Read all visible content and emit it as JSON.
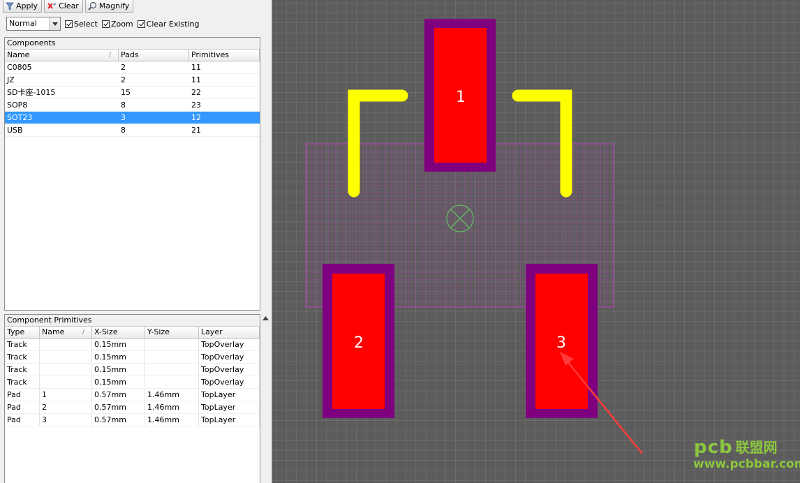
{
  "toolbar": {
    "apply_label": "Apply",
    "clear_label": "Clear",
    "magnify_label": "Magnify"
  },
  "options": {
    "mode_value": "Normal",
    "select_label": "Select",
    "zoom_label": "Zoom",
    "clear_existing_label": "Clear Existing"
  },
  "components": {
    "title": "Components",
    "columns": [
      "Name",
      "Pads",
      "Primitives"
    ],
    "rows": [
      {
        "name": "C0805",
        "pads": "2",
        "primitives": "11"
      },
      {
        "name": "JZ",
        "pads": "2",
        "primitives": "11"
      },
      {
        "name": "SD卡座-1015",
        "pads": "15",
        "primitives": "22"
      },
      {
        "name": "SOP8",
        "pads": "8",
        "primitives": "23"
      },
      {
        "name": "SOT23",
        "pads": "3",
        "primitives": "12"
      },
      {
        "name": "USB",
        "pads": "8",
        "primitives": "21"
      }
    ],
    "selected_index": 4
  },
  "primitives": {
    "title": "Component Primitives",
    "columns": [
      "Type",
      "Name",
      "X-Size",
      "Y-Size",
      "Layer"
    ],
    "rows": [
      {
        "type": "Track",
        "name": "",
        "xsize": "0.15mm",
        "ysize": "",
        "layer": "TopOverlay"
      },
      {
        "type": "Track",
        "name": "",
        "xsize": "0.15mm",
        "ysize": "",
        "layer": "TopOverlay"
      },
      {
        "type": "Track",
        "name": "",
        "xsize": "0.15mm",
        "ysize": "",
        "layer": "TopOverlay"
      },
      {
        "type": "Track",
        "name": "",
        "xsize": "0.15mm",
        "ysize": "",
        "layer": "TopOverlay"
      },
      {
        "type": "Pad",
        "name": "1",
        "xsize": "0.57mm",
        "ysize": "1.46mm",
        "layer": "TopLayer"
      },
      {
        "type": "Pad",
        "name": "2",
        "xsize": "0.57mm",
        "ysize": "1.46mm",
        "layer": "TopLayer"
      },
      {
        "type": "Pad",
        "name": "3",
        "xsize": "0.57mm",
        "ysize": "1.46mm",
        "layer": "TopLayer"
      }
    ]
  },
  "canvas": {
    "pad_labels": [
      "1",
      "2",
      "3"
    ],
    "colors": {
      "background": "#5c5c5c",
      "grid": "#7a7a7a",
      "pad_fill": "#ff0000",
      "solder_mask": "#7f007f",
      "silkscreen": "#ffff00",
      "courtyard": "#c040c0",
      "origin": "#66bb66"
    }
  },
  "watermark": {
    "logo": "pcb",
    "cn_text": "联盟网",
    "url": "www.pcbbar.com"
  }
}
